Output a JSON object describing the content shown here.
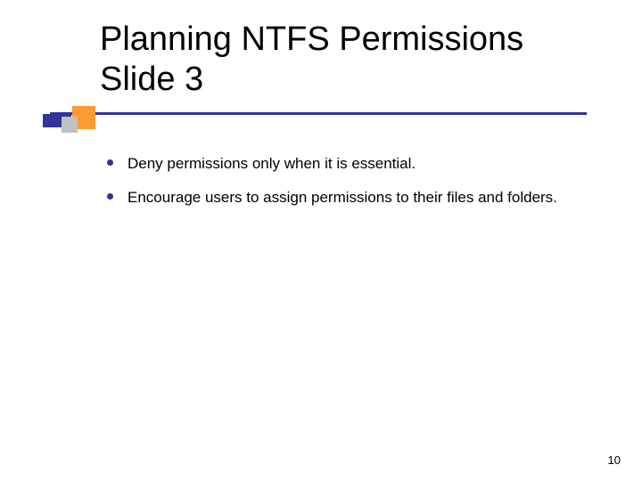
{
  "title": {
    "line1": "Planning NTFS Permissions",
    "line2": "Slide 3"
  },
  "bullets": [
    "Deny permissions only when it is essential.",
    "Encourage users to assign permissions to their files and folders."
  ],
  "page_number": "10",
  "colors": {
    "accent_primary": "#333399",
    "accent_orange": "#ff9933",
    "accent_gray": "#c0c0c0"
  }
}
